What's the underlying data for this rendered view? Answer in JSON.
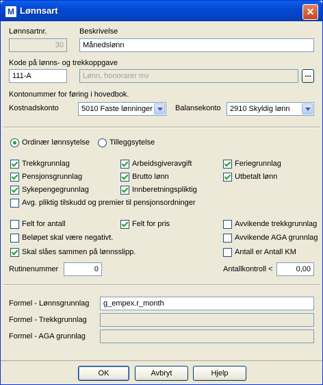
{
  "window": {
    "title": "Lønnsart"
  },
  "fields": {
    "lonnsartnr_label": "Lønnsartnr.",
    "lonnsartnr_value": "30",
    "beskrivelse_label": "Beskrivelse",
    "beskrivelse_value": "Månedslønn",
    "kode_label": "Kode på lønns- og trekkoppgave",
    "kode_value": "111-A",
    "kode_desc": "Lønn, honorarer mv",
    "kode_browse": "...",
    "konto_heading": "Kontonummer for føring i hovedbok.",
    "kostnadskonto_label": "Kostnadskonto",
    "kostnadskonto_value": "5010 Faste lønninger",
    "balansekonto_label": "Balansekonto",
    "balansekonto_value": "2910 Skyldig lønn"
  },
  "radios": [
    {
      "label": "Ordinær lønnsytelse",
      "checked": true
    },
    {
      "label": "Tilleggsytelse",
      "checked": false
    }
  ],
  "checkboxes": {
    "trekkgrunnlag": {
      "label": "Trekkgrunnlag",
      "checked": true
    },
    "pensjonsgrunnlag": {
      "label": "Pensjonsgrunnlag",
      "checked": true
    },
    "sykepengegrunnlag": {
      "label": "Sykepengegrunnlag",
      "checked": true
    },
    "arbeidsgiveravgift": {
      "label": "Arbeidsgiveravgift",
      "checked": true
    },
    "brutto_lonn": {
      "label": "Brutto lønn",
      "checked": true
    },
    "innberetningspliktig": {
      "label": "Innberetningspliktig",
      "checked": true
    },
    "feriegrunnlag": {
      "label": "Feriegrunnlag",
      "checked": true
    },
    "utbetalt_lonn": {
      "label": "Utbetalt lønn",
      "checked": true
    },
    "avg_pliktig": {
      "label": "Avg. pliktig tilskudd og premier til pensjonsordninger",
      "checked": false
    },
    "felt_antall": {
      "label": "Felt for antall",
      "checked": false
    },
    "belopet_negativt": {
      "label": "Beløpet skal være negativt.",
      "checked": false
    },
    "skal_slaas": {
      "label": "Skal slåes sammen på lønnsslipp.",
      "checked": true
    },
    "felt_pris": {
      "label": "Felt for pris",
      "checked": true
    },
    "avvikende_trekk": {
      "label": "Avvikende trekkgrunnlag",
      "checked": false
    },
    "avvikende_aga": {
      "label": "Avvikende AGA grunnlag",
      "checked": false
    },
    "antall_km": {
      "label": "Antall er Antall KM",
      "checked": false
    }
  },
  "rutine": {
    "label": "Rutinenummer",
    "value": "0"
  },
  "antallkontroll": {
    "label": "Antallkontroll <",
    "value": "0,00"
  },
  "formel": {
    "lonns_label": "Formel - Lønnsgrunnlag",
    "lonns_value": "g_empex.r_month",
    "trekk_label": "Formel - Trekkgrunnlag",
    "trekk_value": "",
    "aga_label": "Formel - AGA grunnlag",
    "aga_value": ""
  },
  "buttons": {
    "ok": "OK",
    "avbryt": "Avbryt",
    "hjelp": "Hjelp"
  }
}
